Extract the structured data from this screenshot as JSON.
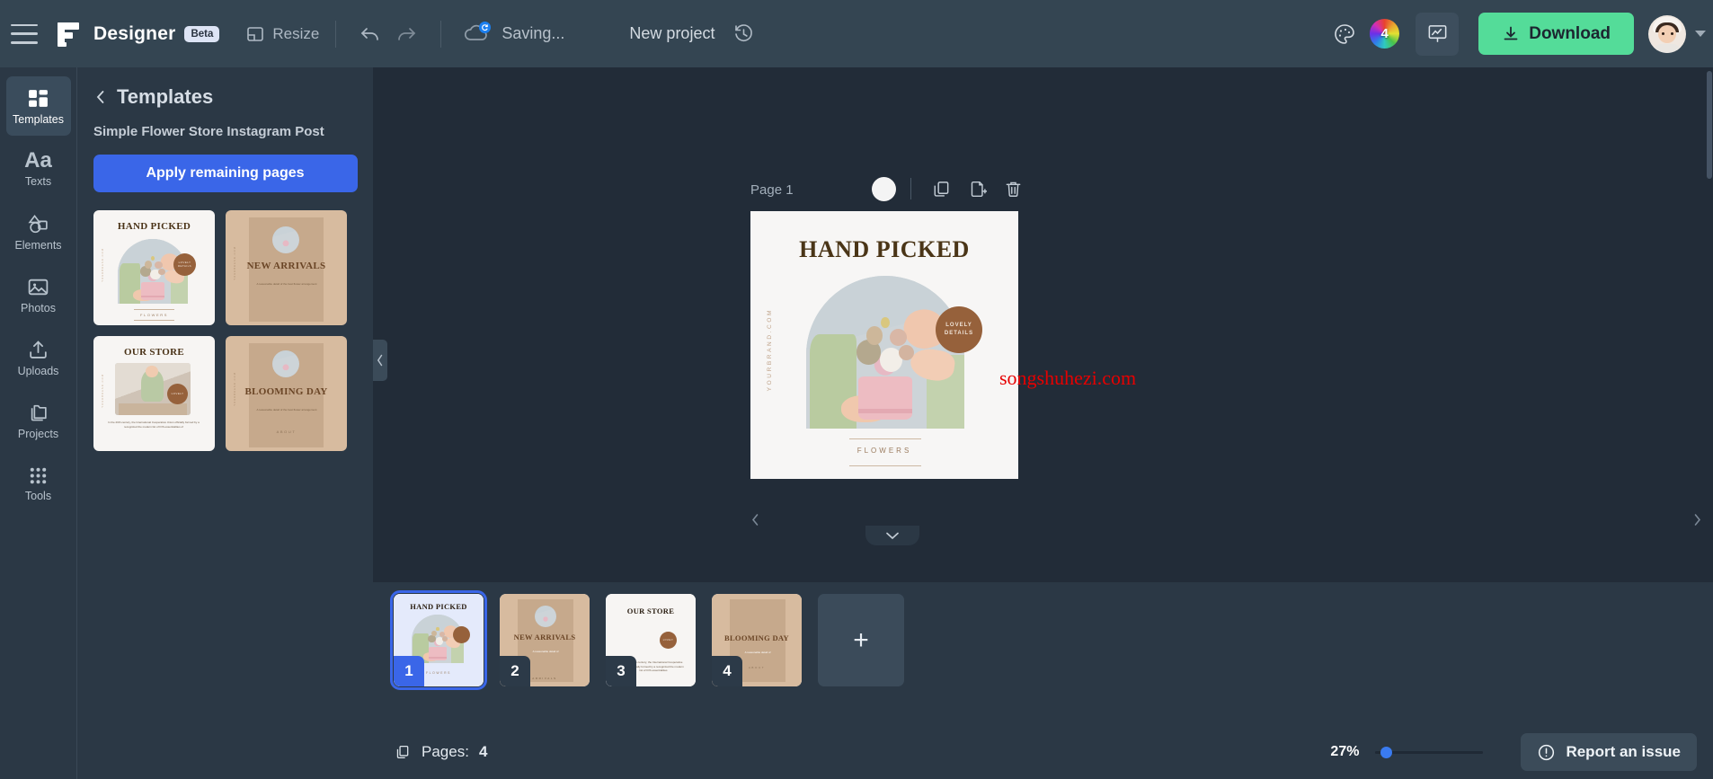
{
  "topbar": {
    "menu_icon": "hamburger-icon",
    "logo_icon": "designer-logo-icon",
    "app_title": "Designer",
    "beta_label": "Beta",
    "resize_label": "Resize",
    "undo_icon": "undo-icon",
    "redo_icon": "redo-icon",
    "save_status": "Saving...",
    "cloud_icon": "cloud-sync-icon",
    "project_name": "New project",
    "history_icon": "history-icon",
    "palette_icon": "palette-icon",
    "colorwheel_count": "4",
    "present_icon": "present-icon",
    "download_label": "Download",
    "download_icon": "download-icon",
    "avatar_caret": "chevron-down-icon"
  },
  "rail": {
    "items": [
      {
        "label": "Templates",
        "icon": "templates-icon",
        "active": true
      },
      {
        "label": "Texts",
        "icon": "text-icon",
        "active": false
      },
      {
        "label": "Elements",
        "icon": "elements-icon",
        "active": false
      },
      {
        "label": "Photos",
        "icon": "photos-icon",
        "active": false
      },
      {
        "label": "Uploads",
        "icon": "uploads-icon",
        "active": false
      },
      {
        "label": "Projects",
        "icon": "projects-icon",
        "active": false
      },
      {
        "label": "Tools",
        "icon": "tools-icon",
        "active": false
      }
    ]
  },
  "panel": {
    "back_icon": "chevron-left-icon",
    "title": "Templates",
    "subtitle": "Simple Flower Store Instagram Post",
    "apply_label": "Apply remaining pages",
    "templates": [
      {
        "title": "HAND PICKED",
        "caption": "FLOWERS",
        "badge": "LOVELY DETAILS",
        "side": "YOURBRAND.COM",
        "style": "white"
      },
      {
        "title": "NEW ARRIVALS",
        "caption": "",
        "badge": "",
        "side": "YOURBRAND.COM",
        "style": "tan"
      },
      {
        "title": "OUR STORE",
        "caption": "",
        "badge": "LOVELY",
        "side": "YOURBRAND.COM",
        "style": "white"
      },
      {
        "title": "BLOOMING DAY",
        "caption": "ABOUT",
        "badge": "",
        "side": "YOURBRAND.COM",
        "style": "tan"
      }
    ]
  },
  "canvas": {
    "page_label": "Page 1",
    "bg_color": "#f4f4f4",
    "bg_circle_name": "page-background-color",
    "duplicate_icon": "duplicate-page-icon",
    "addpage_icon": "add-page-icon",
    "delete_icon": "delete-page-icon",
    "scroll_left_icon": "scroll-left-icon",
    "scroll_right_icon": "scroll-right-icon",
    "collapse_icon": "chevron-down-icon",
    "panel_handle_icon": "chevron-left-icon",
    "watermark": "songshuhezi.com",
    "artboard": {
      "title": "HAND PICKED",
      "side_text": "YOURBRAND.COM",
      "badge_line1": "LOVELY",
      "badge_line2": "DETAILS",
      "caption": "FLOWERS"
    }
  },
  "pages_strip": {
    "pages": [
      {
        "number": "1",
        "title": "HAND PICKED",
        "caption": "FLOWERS",
        "style": "white",
        "selected": true
      },
      {
        "number": "2",
        "title": "NEW ARRIVALS",
        "caption": "",
        "style": "tan",
        "selected": false
      },
      {
        "number": "3",
        "title": "OUR STORE",
        "caption": "",
        "style": "white",
        "selected": false
      },
      {
        "number": "4",
        "title": "BLOOMING DAY",
        "caption": "",
        "style": "tan",
        "selected": false
      }
    ],
    "add_label": "+",
    "pages_count_label": "Pages:",
    "pages_count_value": "4",
    "pages_icon": "pages-icon",
    "zoom_value": "27%",
    "report_label": "Report an issue",
    "report_icon": "warning-circle-icon"
  },
  "colors": {
    "accent_blue": "#3a66e8",
    "download_green": "#54dc99",
    "topbar_bg": "#344552",
    "panel_bg": "#2b3845",
    "canvas_bg": "#222c38",
    "watermark_red": "#e60000",
    "badge_brown": "#96613b"
  }
}
